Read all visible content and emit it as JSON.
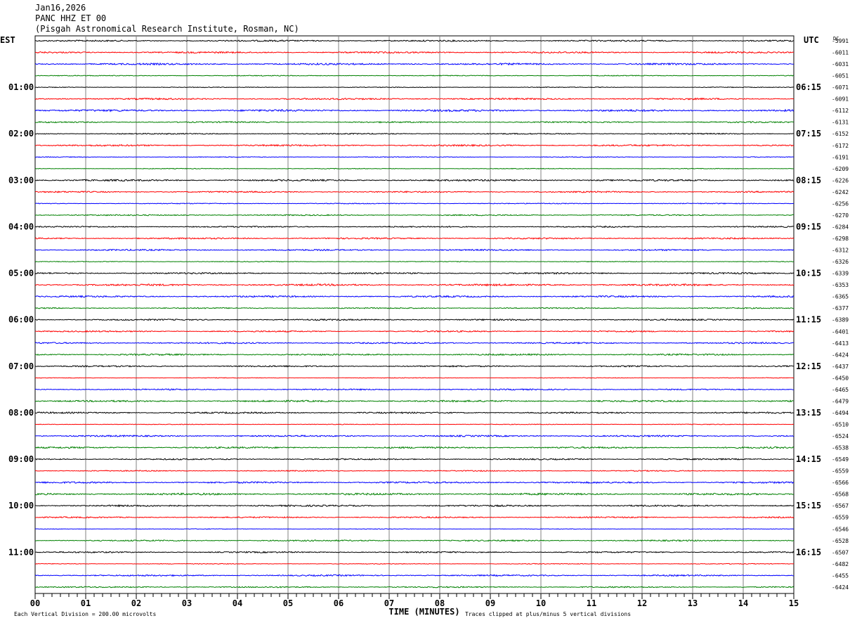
{
  "header": {
    "date": "Jan16,2026",
    "station": "PANC HHZ ET 00",
    "site": "(Pisgah Astronomical Research Institute, Rosman, NC)"
  },
  "chart_data": {
    "type": "line",
    "left_timezone": "EST",
    "right_timezone": "UTC",
    "dc_label": "DC",
    "minutes_per_line": 15,
    "trace_colors": [
      "#000000",
      "#ff0000",
      "#0000ff",
      "#008000"
    ],
    "left_hour_labels": [
      "01:00",
      "02:00",
      "03:00",
      "04:00",
      "05:00",
      "06:00",
      "07:00",
      "08:00",
      "09:00",
      "10:00",
      "11:00"
    ],
    "right_hour_labels": [
      "06:15",
      "07:15",
      "08:15",
      "09:15",
      "10:15",
      "11:15",
      "12:15",
      "13:15",
      "14:15",
      "15:15",
      "16:15"
    ],
    "dc_offsets": [
      -5991,
      -6011,
      -6031,
      -6051,
      -6071,
      -6091,
      -6112,
      -6131,
      -6152,
      -6172,
      -6191,
      -6209,
      -6226,
      -6242,
      -6256,
      -6270,
      -6284,
      -6298,
      -6312,
      -6326,
      -6339,
      -6353,
      -6365,
      -6377,
      -6389,
      -6401,
      -6413,
      -6424,
      -6437,
      -6450,
      -6465,
      -6479,
      -6494,
      -6510,
      -6524,
      -6538,
      -6549,
      -6559,
      -6566,
      -6568,
      -6567,
      -6559,
      -6546,
      -6528,
      -6507,
      -6482,
      -6455,
      -6424
    ],
    "x_ticks": [
      "00",
      "01",
      "02",
      "03",
      "04",
      "05",
      "06",
      "07",
      "08",
      "09",
      "10",
      "11",
      "12",
      "13",
      "14",
      "15"
    ],
    "xlabel": "TIME (MINUTES)",
    "scale_note": "Each Vertical Division =  200.00 microvolts",
    "clip_note": "Traces clipped at plus/minus 5 vertical divisions",
    "grid": true
  }
}
